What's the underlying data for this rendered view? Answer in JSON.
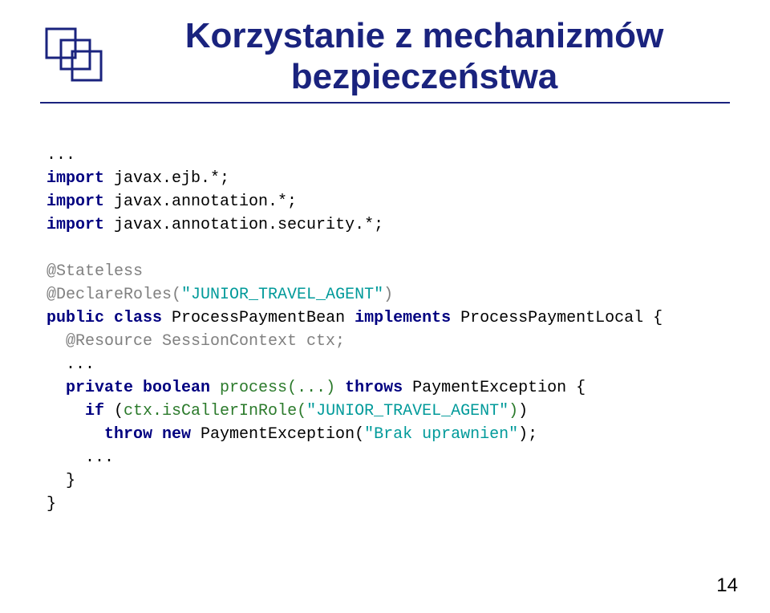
{
  "title": "Korzystanie z mechanizmów bezpieczeństwa",
  "code": {
    "dots1": "...",
    "imp1a": "import",
    "imp1b": " javax.ejb.*;",
    "imp2a": "import",
    "imp2b": " javax.annotation.*;",
    "imp3a": "import",
    "imp3b": " javax.annotation.security.*;",
    "stateless": "@Stateless",
    "declRoles1": "@DeclareRoles(",
    "declRoles2": "\"JUNIOR_TRAVEL_AGENT\"",
    "declRoles3": ")",
    "pubclass": "public class",
    "beanname": " ProcessPaymentBean ",
    "impl": "implements",
    "localname": " ProcessPaymentLocal {",
    "resourceLine": "  @Resource SessionContext ctx;",
    "dots2": "  ...",
    "priv": "  private boolean",
    "procname": " process(...) ",
    "throws": "throws",
    "exc": " PaymentException {",
    "if": "    if",
    "cond1": " (",
    "cond2": "ctx.isCallerInRole(",
    "cond3": "\"JUNIOR_TRAVEL_AGENT\"",
    "cond4": ")",
    "cond5": ")",
    "throw": "      throw new",
    "newexc": " PaymentException(",
    "msg": "\"Brak uprawnien\"",
    "newexc2": ");",
    "dots3": "    ...",
    "brace1": "  }",
    "brace2": "}"
  },
  "page": "14"
}
